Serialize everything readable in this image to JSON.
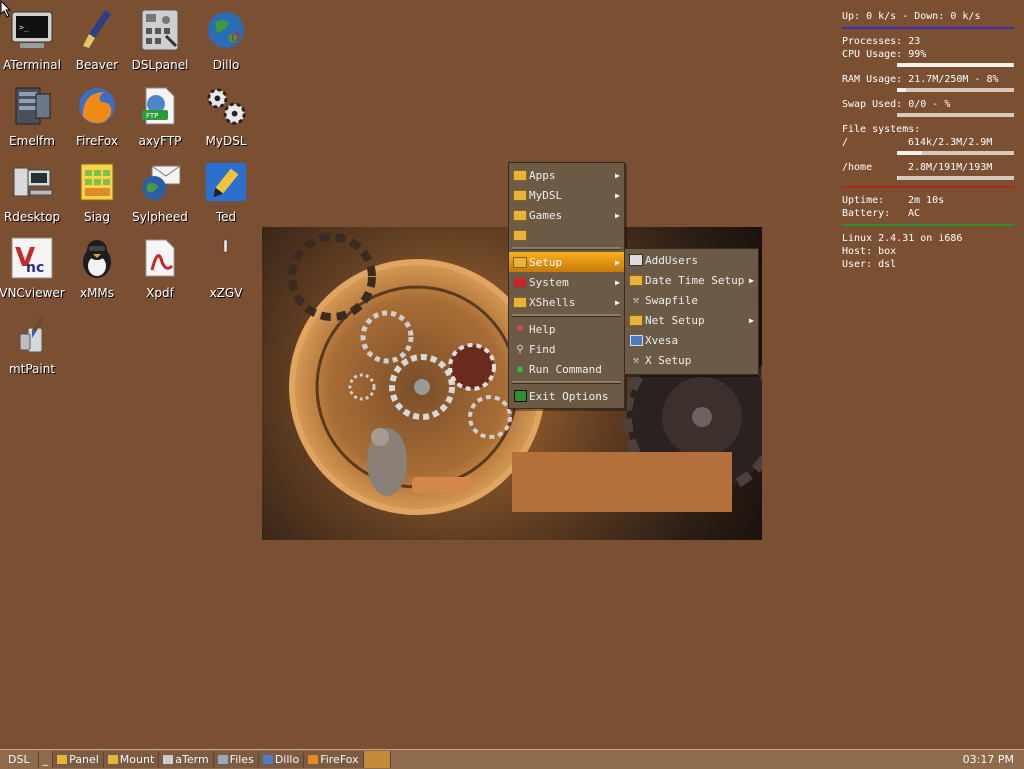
{
  "desktop_icons": [
    {
      "label": "ATerminal",
      "icon": "terminal-icon"
    },
    {
      "label": "Beaver",
      "icon": "paintbrush-icon"
    },
    {
      "label": "DSLpanel",
      "icon": "control-panel-icon"
    },
    {
      "label": "Dillo",
      "icon": "globe-icon"
    },
    {
      "label": "Emelfm",
      "icon": "file-manager-icon"
    },
    {
      "label": "FireFox",
      "icon": "firefox-icon"
    },
    {
      "label": "axyFTP",
      "icon": "ftp-icon"
    },
    {
      "label": "MyDSL",
      "icon": "gears-icon"
    },
    {
      "label": "Rdesktop",
      "icon": "remote-desktop-icon"
    },
    {
      "label": "Siag",
      "icon": "spreadsheet-icon"
    },
    {
      "label": "Sylpheed",
      "icon": "mail-icon"
    },
    {
      "label": "Ted",
      "icon": "pen-icon"
    },
    {
      "label": "VNCviewer",
      "icon": "vnc-icon"
    },
    {
      "label": "xMMs",
      "icon": "penguin-icon"
    },
    {
      "label": "Xpdf",
      "icon": "pdf-icon"
    },
    {
      "label": "xZGV",
      "icon": "image-viewer-icon"
    },
    {
      "label": "mtPaint",
      "icon": "paint-icon"
    }
  ],
  "conky": {
    "net": "Up: 0 k/s - Down: 0 k/s",
    "processes": "Processes: 23",
    "cpu": "CPU Usage: 99%",
    "cpu_level": 0.99,
    "ram": "RAM Usage: 21.7M/250M - 8%",
    "ram_level": 0.08,
    "swap": "Swap Used: 0/0 - %",
    "swap_level": 0.0,
    "fs_title": "File systems:",
    "fs_root_label": "/",
    "fs_root_value": "614k/2.3M/2.9M",
    "fs_root_level": 0.21,
    "fs_home_label": "/home",
    "fs_home_value": "2.8M/191M/193M",
    "fs_home_level": 0.01,
    "uptime_label": "Uptime:",
    "uptime_value": "2m 10s",
    "battery_label": "Battery:",
    "battery_value": "AC",
    "kernel": "Linux 2.4.31 on i686",
    "host": "Host: box",
    "user": "User: dsl",
    "colors": {
      "net_rule": "#3a2fb8",
      "fs_rule": "#b5241a",
      "info_rule": "#2f8f2f"
    }
  },
  "main_menu": {
    "items": [
      {
        "label": "Apps",
        "icon": "folder-icon",
        "submenu": true
      },
      {
        "label": "MyDSL",
        "icon": "folder-icon",
        "submenu": true
      },
      {
        "label": "Games",
        "icon": "folder-icon",
        "submenu": true
      },
      {
        "label": "",
        "icon": "folder-icon",
        "submenu": false
      },
      {
        "label": "Setup",
        "icon": "folder-icon",
        "submenu": true,
        "active": true
      },
      {
        "label": "System",
        "icon": "system-icon",
        "submenu": true
      },
      {
        "label": "XShells",
        "icon": "folder-icon",
        "submenu": true
      },
      {
        "label": "Help",
        "icon": "help-icon",
        "submenu": false
      },
      {
        "label": "Find",
        "icon": "find-icon",
        "submenu": false
      },
      {
        "label": "Run Command",
        "icon": "run-icon",
        "submenu": false
      },
      {
        "label": "Exit Options",
        "icon": "exit-icon",
        "submenu": false
      }
    ]
  },
  "setup_menu": {
    "items": [
      {
        "label": "AddUsers",
        "icon": "users-icon",
        "submenu": false
      },
      {
        "label": "Date Time Setup",
        "icon": "folder-icon",
        "submenu": true
      },
      {
        "label": "Swapfile",
        "icon": "tool-icon",
        "submenu": false
      },
      {
        "label": "Net Setup",
        "icon": "folder-icon",
        "submenu": true
      },
      {
        "label": "Xvesa",
        "icon": "monitor-icon",
        "submenu": false
      },
      {
        "label": "X Setup",
        "icon": "tool-icon",
        "submenu": false
      }
    ]
  },
  "taskbar": {
    "start_label": "DSL",
    "min_label": "_",
    "tasks": [
      "Panel",
      "Mount",
      "aTerm",
      "Files",
      "Dillo",
      "FireFox"
    ],
    "clock": "03:17 PM"
  }
}
